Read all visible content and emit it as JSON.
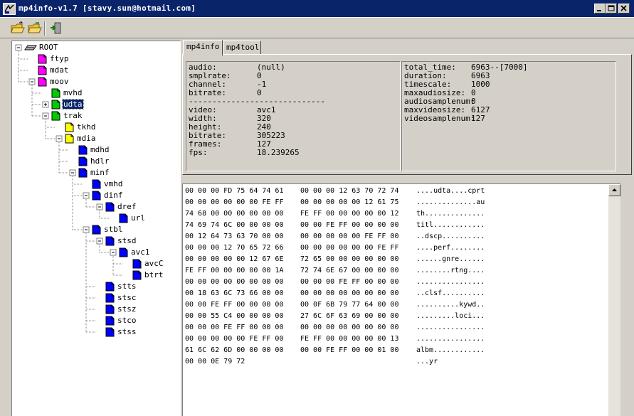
{
  "window": {
    "title": "mp4info-v1.7 [stavy.sun@hotmail.com]",
    "buttons": [
      "minimize",
      "maximize",
      "close"
    ]
  },
  "toolbar": {
    "buttons": [
      {
        "name": "open-folder-icon"
      },
      {
        "name": "open-folder-alt-icon"
      },
      {
        "name": "exit-icon"
      }
    ]
  },
  "tree": {
    "nodes": [
      {
        "label": "ROOT",
        "depth": 0,
        "color": "root",
        "expander": "minus"
      },
      {
        "label": "ftyp",
        "depth": 1,
        "color": "#ff00ff",
        "expander": ""
      },
      {
        "label": "mdat",
        "depth": 1,
        "color": "#ff00ff",
        "expander": ""
      },
      {
        "label": "moov",
        "depth": 1,
        "color": "#ff00ff",
        "expander": "minus"
      },
      {
        "label": "mvhd",
        "depth": 2,
        "color": "#00cc00",
        "expander": ""
      },
      {
        "label": "udta",
        "depth": 2,
        "color": "#00cc00",
        "expander": "plus",
        "selected": true
      },
      {
        "label": "trak",
        "depth": 2,
        "color": "#00cc00",
        "expander": "minus"
      },
      {
        "label": "tkhd",
        "depth": 3,
        "color": "#ffff00",
        "expander": ""
      },
      {
        "label": "mdia",
        "depth": 3,
        "color": "#ffff00",
        "expander": "minus"
      },
      {
        "label": "mdhd",
        "depth": 4,
        "color": "#0000ff",
        "expander": ""
      },
      {
        "label": "hdlr",
        "depth": 4,
        "color": "#0000ff",
        "expander": ""
      },
      {
        "label": "minf",
        "depth": 4,
        "color": "#0000ff",
        "expander": "minus"
      },
      {
        "label": "vmhd",
        "depth": 5,
        "color": "#0000ff",
        "expander": ""
      },
      {
        "label": "dinf",
        "depth": 5,
        "color": "#0000ff",
        "expander": "minus"
      },
      {
        "label": "dref",
        "depth": 6,
        "color": "#0000ff",
        "expander": "minus"
      },
      {
        "label": "url",
        "depth": 7,
        "color": "#0000ff",
        "expander": ""
      },
      {
        "label": "stbl",
        "depth": 5,
        "color": "#0000ff",
        "expander": "minus"
      },
      {
        "label": "stsd",
        "depth": 6,
        "color": "#0000ff",
        "expander": "minus"
      },
      {
        "label": "avc1",
        "depth": 7,
        "color": "#0000ff",
        "expander": "minus"
      },
      {
        "label": "avcC",
        "depth": 8,
        "color": "#0000ff",
        "expander": ""
      },
      {
        "label": "btrt",
        "depth": 8,
        "color": "#0000ff",
        "expander": ""
      },
      {
        "label": "stts",
        "depth": 6,
        "color": "#0000ff",
        "expander": ""
      },
      {
        "label": "stsc",
        "depth": 6,
        "color": "#0000ff",
        "expander": ""
      },
      {
        "label": "stsz",
        "depth": 6,
        "color": "#0000ff",
        "expander": ""
      },
      {
        "label": "stco",
        "depth": 6,
        "color": "#0000ff",
        "expander": ""
      },
      {
        "label": "stss",
        "depth": 6,
        "color": "#0000ff",
        "expander": ""
      }
    ]
  },
  "tabs": [
    {
      "label": "mp4info",
      "active": true
    },
    {
      "label": "mp4tool",
      "active": false
    }
  ],
  "info_left": [
    {
      "key": "audio:",
      "value": " (null)"
    },
    {
      "key": "smplrate:",
      "value": "0"
    },
    {
      "key": "channel:",
      "value": "-1"
    },
    {
      "key": "bitrate:",
      "value": "0"
    },
    {
      "key": "-----------------------------",
      "value": ""
    },
    {
      "key": "video:",
      "value": "avc1"
    },
    {
      "key": "width:",
      "value": "320"
    },
    {
      "key": "height:",
      "value": "240"
    },
    {
      "key": "bitrate:",
      "value": "305223"
    },
    {
      "key": "frames:",
      "value": "127"
    },
    {
      "key": "fps:",
      "value": "18.239265"
    }
  ],
  "info_right": [
    {
      "key": "total_time:",
      "value": "6963--[7000]"
    },
    {
      "key": "duration:",
      "value": "6963"
    },
    {
      "key": "timescale:",
      "value": "1000"
    },
    {
      "key": "maxaudiosize:",
      "value": "0"
    },
    {
      "key": "audiosamplenum:",
      "value": "0"
    },
    {
      "key": "maxvideosize:",
      "value": "6127"
    },
    {
      "key": "videosamplenum:",
      "value": "127"
    }
  ],
  "hex": [
    {
      "a": "00 00 00 FD 75 64 74 61",
      "b": "00 00 00 12 63 70 72 74",
      "c": "....udta....cprt"
    },
    {
      "a": "00 00 00 00 00 00 FE FF",
      "b": "00 00 00 00 00 12 61 75",
      "c": "..............au"
    },
    {
      "a": "74 68 00 00 00 00 00 00",
      "b": "FE FF 00 00 00 00 00 12",
      "c": "th.............."
    },
    {
      "a": "74 69 74 6C 00 00 00 00",
      "b": "00 00 FE FF 00 00 00 00",
      "c": "titl............"
    },
    {
      "a": "00 12 64 73 63 70 00 00",
      "b": "00 00 00 00 00 FE FF 00",
      "c": "..dscp.........."
    },
    {
      "a": "00 00 00 12 70 65 72 66",
      "b": "00 00 00 00 00 00 FE FF",
      "c": "....perf........"
    },
    {
      "a": "00 00 00 00 00 12 67 6E",
      "b": "72 65 00 00 00 00 00 00",
      "c": "......gnre......"
    },
    {
      "a": "FE FF 00 00 00 00 00 1A",
      "b": "72 74 6E 67 00 00 00 00",
      "c": "........rtng...."
    },
    {
      "a": "00 00 00 00 00 00 00 00",
      "b": "00 00 00 FE FF 00 00 00",
      "c": "................"
    },
    {
      "a": "00 18 63 6C 73 66 00 00",
      "b": "00 00 00 00 00 00 00 00",
      "c": "..clsf.........."
    },
    {
      "a": "00 00 FE FF 00 00 00 00",
      "b": "00 0F 6B 79 77 64 00 00",
      "c": "..........kywd.."
    },
    {
      "a": "00 00 55 C4 00 00 00 00",
      "b": "27 6C 6F 63 69 00 00 00",
      "c": ".........loci..."
    },
    {
      "a": "00 00 00 FE FF 00 00 00",
      "b": "00 00 00 00 00 00 00 00",
      "c": "................"
    },
    {
      "a": "00 00 00 00 00 FE FF 00",
      "b": "FE FF 00 00 00 00 00 13",
      "c": "................"
    },
    {
      "a": "61 6C 62 6D 00 00 00 00",
      "b": "00 00 FE FF 00 00 01 00",
      "c": "albm............"
    },
    {
      "a": "00 00 0E 79 72",
      "b": "",
      "c": "...yr"
    }
  ]
}
